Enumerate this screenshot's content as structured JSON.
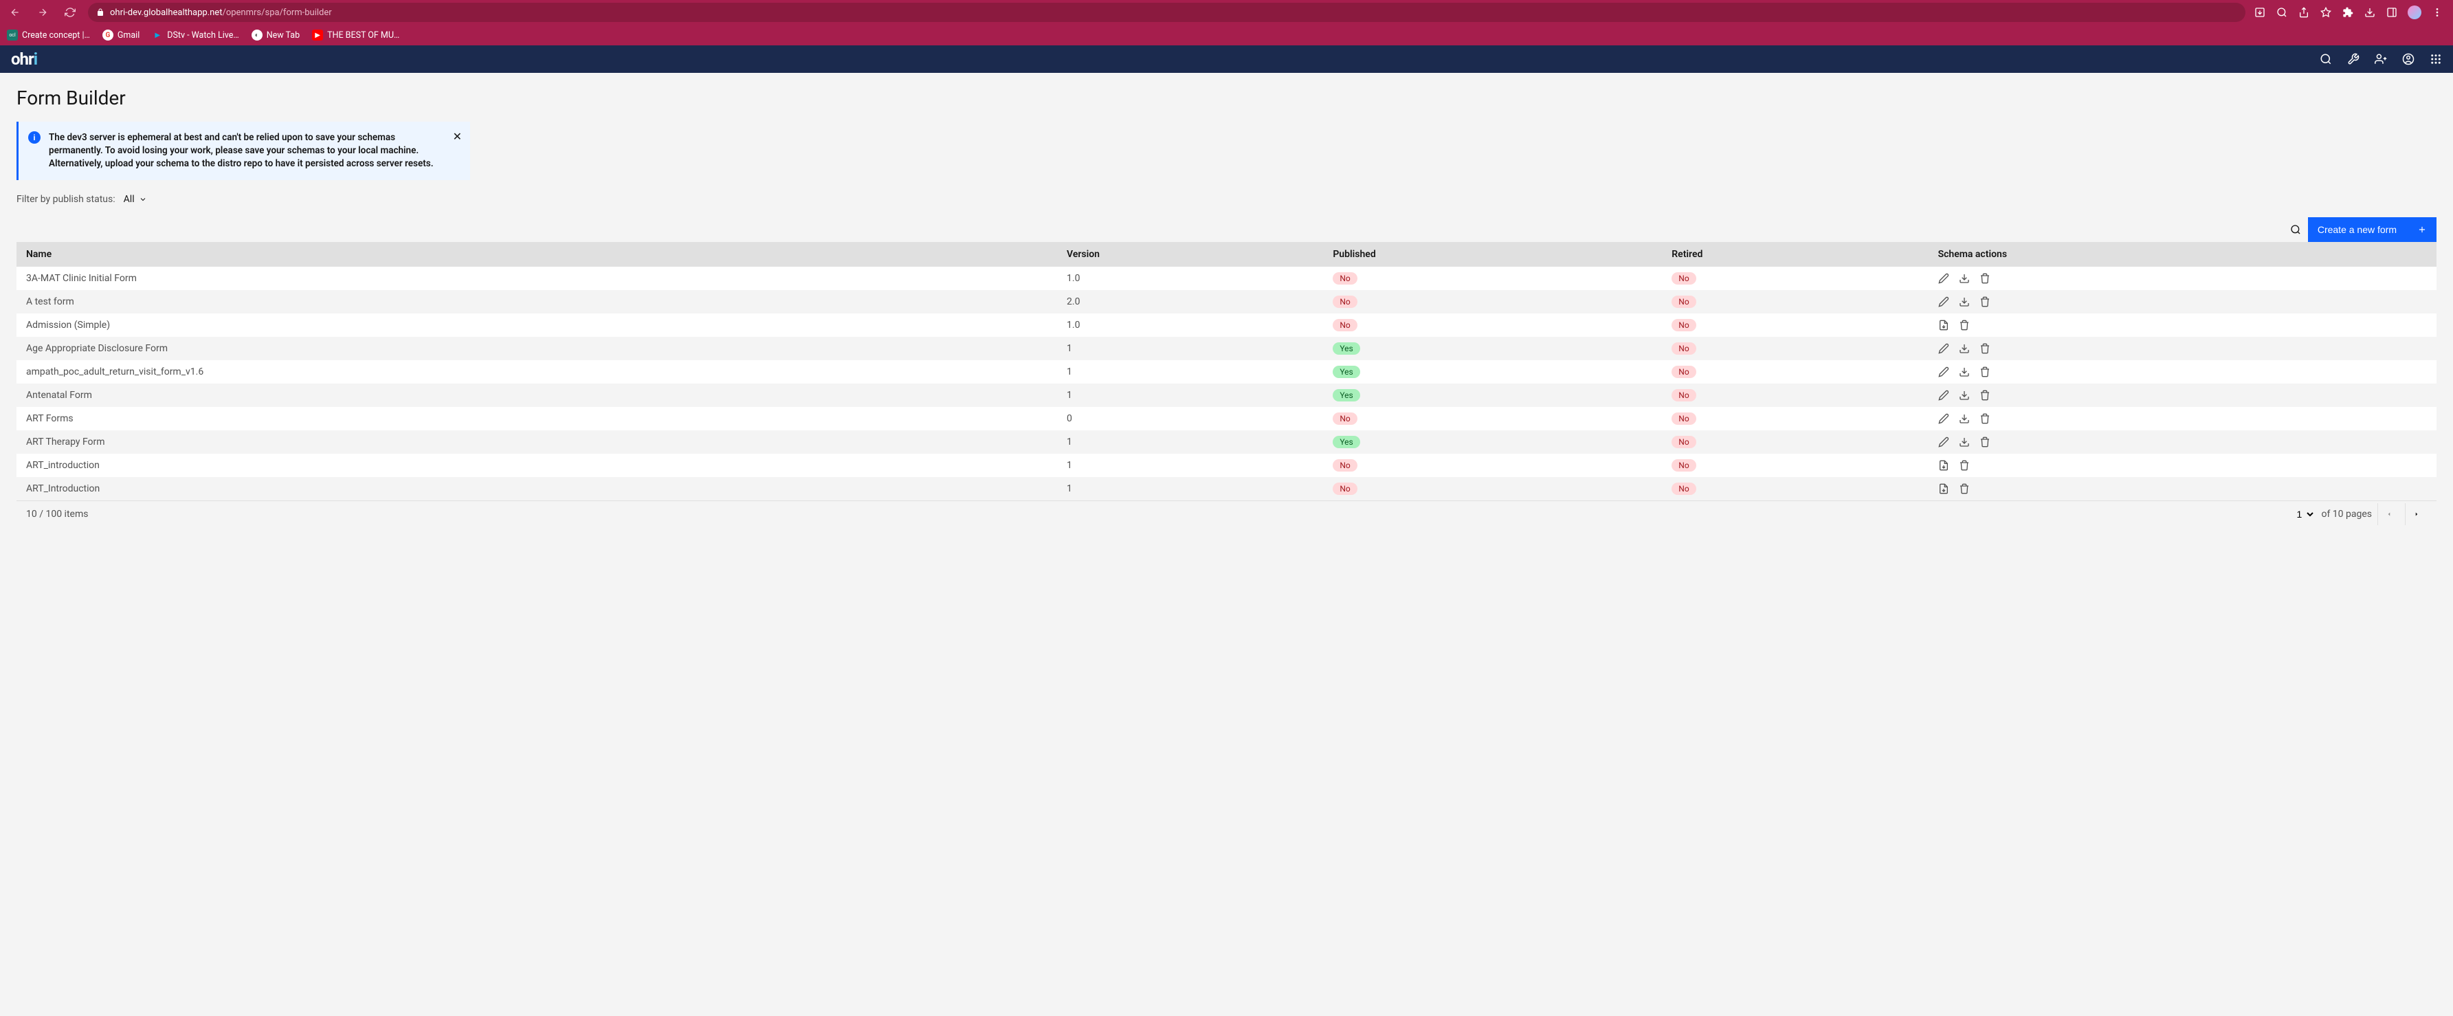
{
  "browser": {
    "url_domain": "ohri-dev.globalhealthapp.net",
    "url_path": "/openmrs/spa/form-builder",
    "bookmarks": [
      {
        "label": "Create concept |…",
        "icon": "ocl",
        "color": "#1b7a6d"
      },
      {
        "label": "Gmail",
        "icon": "G",
        "color": "#fff"
      },
      {
        "label": "DStv - Watch Live…",
        "icon": "▶",
        "color": "#06a7e1"
      },
      {
        "label": "New Tab",
        "icon": "◐",
        "color": "#fff"
      },
      {
        "label": "THE BEST OF MU…",
        "icon": "▶",
        "color": "#ff0000"
      }
    ]
  },
  "header": {
    "logo": "ohri"
  },
  "page": {
    "title": "Form Builder"
  },
  "notification": {
    "message": "The dev3 server is ephemeral at best and can't be relied upon to save your schemas permanently. To avoid losing your work, please save your schemas to your local machine. Alternatively, upload your schema to the distro repo to have it persisted across server resets."
  },
  "filter": {
    "label": "Filter by publish status:",
    "value": "All"
  },
  "toolbar": {
    "create_label": "Create a new form"
  },
  "table": {
    "headers": {
      "name": "Name",
      "version": "Version",
      "published": "Published",
      "retired": "Retired",
      "actions": "Schema actions"
    },
    "rows": [
      {
        "name": "3A-MAT Clinic Initial Form",
        "version": "1.0",
        "published": "No",
        "retired": "No",
        "actions": [
          "edit",
          "download",
          "delete"
        ]
      },
      {
        "name": "A test form",
        "version": "2.0",
        "published": "No",
        "retired": "No",
        "actions": [
          "edit",
          "download",
          "delete"
        ]
      },
      {
        "name": "Admission (Simple)",
        "version": "1.0",
        "published": "No",
        "retired": "No",
        "actions": [
          "import",
          "delete"
        ]
      },
      {
        "name": "Age Appropriate Disclosure Form",
        "version": "1",
        "published": "Yes",
        "retired": "No",
        "actions": [
          "edit",
          "download",
          "delete"
        ]
      },
      {
        "name": "ampath_poc_adult_return_visit_form_v1.6",
        "version": "1",
        "published": "Yes",
        "retired": "No",
        "actions": [
          "edit",
          "download",
          "delete"
        ]
      },
      {
        "name": "Antenatal Form",
        "version": "1",
        "published": "Yes",
        "retired": "No",
        "actions": [
          "edit",
          "download",
          "delete"
        ]
      },
      {
        "name": "ART Forms",
        "version": "0",
        "published": "No",
        "retired": "No",
        "actions": [
          "edit",
          "download",
          "delete"
        ]
      },
      {
        "name": "ART Therapy Form",
        "version": "1",
        "published": "Yes",
        "retired": "No",
        "actions": [
          "edit",
          "download",
          "delete"
        ]
      },
      {
        "name": "ART_introduction",
        "version": "1",
        "published": "No",
        "retired": "No",
        "actions": [
          "import",
          "delete"
        ]
      },
      {
        "name": "ART_Introduction",
        "version": "1",
        "published": "No",
        "retired": "No",
        "actions": [
          "import",
          "delete"
        ]
      }
    ]
  },
  "pagination": {
    "items_label": "10 / 100 items",
    "page": "1",
    "of_label": "of 10 pages"
  }
}
